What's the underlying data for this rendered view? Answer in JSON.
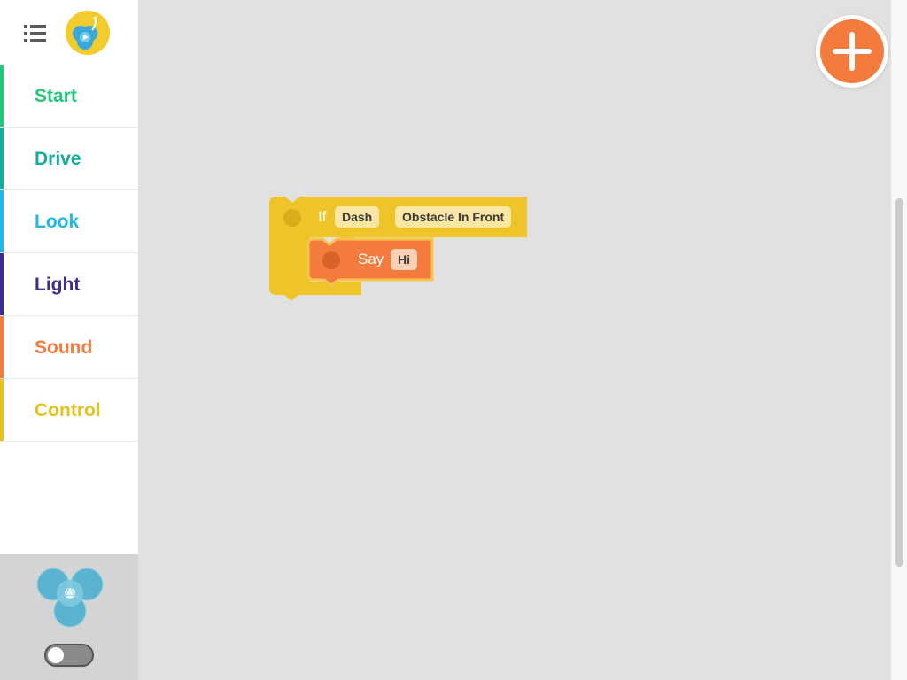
{
  "app": {
    "colors": {
      "workspace_bg": "#e1e1e1",
      "sidebar_bg": "#ffffff",
      "add_button": "#f47b3e",
      "block_control": "#efc429",
      "block_sound": "#f47b3e"
    }
  },
  "header": {
    "menu_icon": "list-menu-icon",
    "logo_icon": "app-logo-icon"
  },
  "categories": [
    {
      "label": "Start",
      "color": "#22c77a"
    },
    {
      "label": "Drive",
      "color": "#13ab9c"
    },
    {
      "label": "Look",
      "color": "#1fb8e6"
    },
    {
      "label": "Light",
      "color": "#3b2e8e"
    },
    {
      "label": "Sound",
      "color": "#f47b3e"
    },
    {
      "label": "Control",
      "color": "#e6c21c"
    }
  ],
  "robot_panel": {
    "robot_icon": "dash-robot-icon",
    "connection_toggle": "off"
  },
  "workspace": {
    "add_button_icon": "plus-icon",
    "if_block": {
      "keyword": "If",
      "robot": "Dash",
      "condition": "Obstacle In Front"
    },
    "say_block": {
      "keyword": "Say",
      "value": "Hi"
    }
  }
}
